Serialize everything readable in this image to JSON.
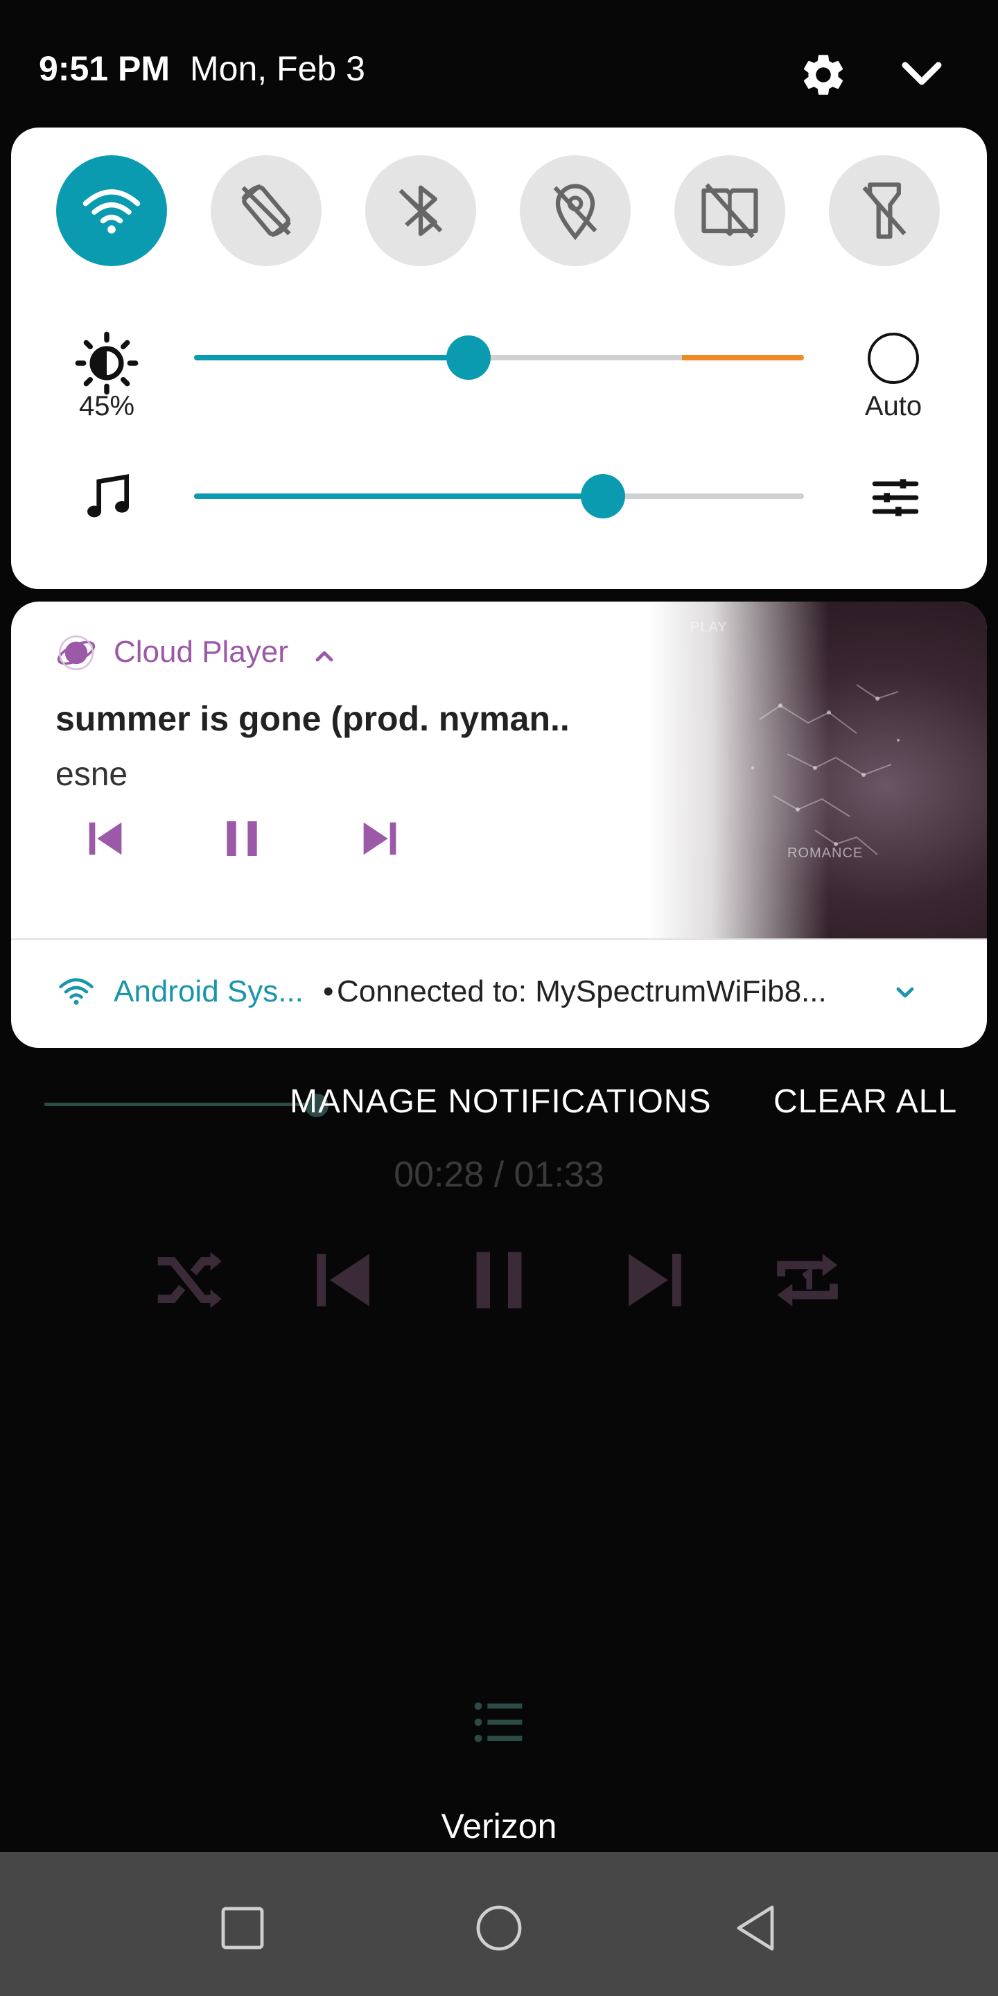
{
  "status_bar": {
    "time": "9:51 PM",
    "date": "Mon, Feb 3",
    "settings_icon": "gear-icon",
    "expand_icon": "chevron-down-icon"
  },
  "quick_settings": {
    "tiles": [
      {
        "name": "wifi",
        "icon": "wifi-icon",
        "active": true
      },
      {
        "name": "auto-rotate",
        "icon": "rotate-off-icon",
        "active": false
      },
      {
        "name": "bluetooth",
        "icon": "bluetooth-off-icon",
        "active": false
      },
      {
        "name": "location",
        "icon": "location-off-icon",
        "active": false
      },
      {
        "name": "reader-mode",
        "icon": "book-off-icon",
        "active": false
      },
      {
        "name": "flashlight",
        "icon": "flashlight-off-icon",
        "active": false
      }
    ],
    "brightness": {
      "label": "45%",
      "level": 0.45,
      "auto_label": "Auto"
    },
    "volume": {
      "level": 0.67
    },
    "accent_color": "#0a9bb1",
    "warning_color": "#f08a24"
  },
  "media_notification": {
    "app_name": "Cloud Player",
    "title": "summer is gone (prod. nyman..",
    "artist": "esne",
    "accent_color": "#9b59a8"
  },
  "system_notification": {
    "app_name": "Android Sys...",
    "separator": "•",
    "text": "Connected to: MySpectrumWiFib8..."
  },
  "actions": {
    "manage": "MANAGE NOTIFICATIONS",
    "clear_all": "CLEAR ALL"
  },
  "background_player": {
    "time": "00:28 / 01:33"
  },
  "carrier": "Verizon"
}
